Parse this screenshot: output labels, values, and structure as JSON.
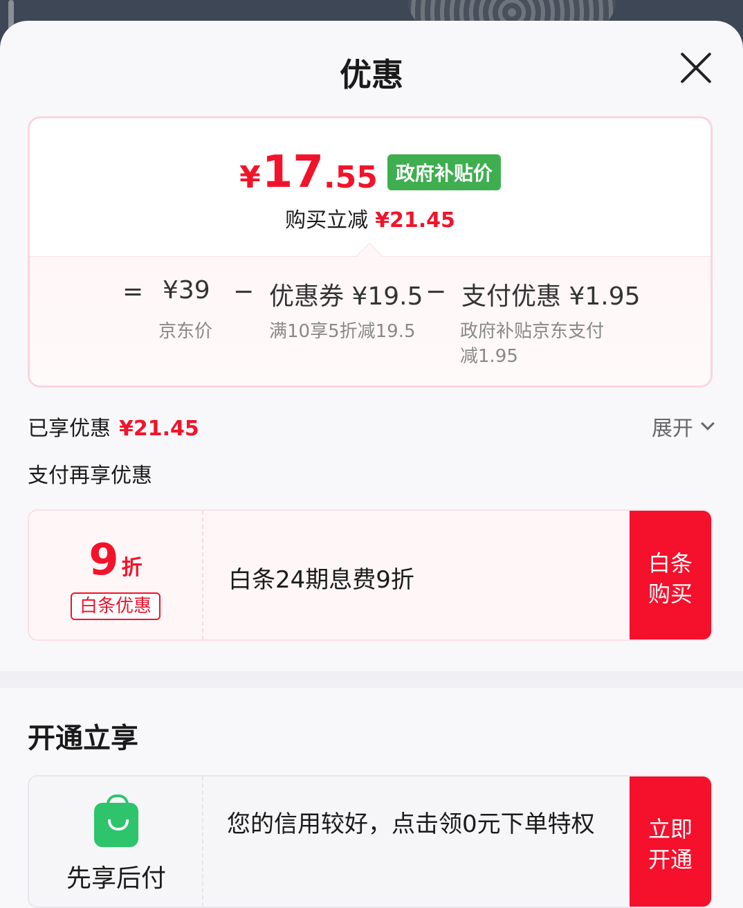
{
  "header": {
    "title": "优惠"
  },
  "price": {
    "yen": "¥",
    "integer": "17",
    "decimal": ".55",
    "tag": "政府补贴价",
    "save_label": "购买立减",
    "save_amount": "¥21.45"
  },
  "formula": {
    "eq": "=",
    "minus": "−",
    "jd_price": "¥39",
    "jd_price_label": "京东价",
    "coupon": "优惠券 ¥19.5",
    "coupon_desc": "满10享5折减19.5",
    "payment": "支付优惠 ¥1.95",
    "payment_desc_1": "政府补贴京东支付",
    "payment_desc_2": "减1.95"
  },
  "enjoyed": {
    "label": "已享优惠",
    "amount": "¥21.45",
    "expand": "展开"
  },
  "pay_again": {
    "label": "支付再享优惠"
  },
  "baitiao_offer": {
    "discount_num": "9",
    "discount_unit": "折",
    "tag": "白条优惠",
    "text": "白条24期息费9折",
    "button_line1": "白条",
    "button_line2": "购买"
  },
  "open_section": {
    "title": "开通立享",
    "product": "先享后付",
    "text": "您的信用较好，点击领0元下单特权",
    "button_line1": "立即",
    "button_line2": "开通"
  },
  "colors": {
    "accent_red": "#f2132b",
    "gov_green": "#3eae4f",
    "bag_green": "#2dc46c"
  },
  "icons": [
    "close-icon",
    "chevron-down-icon",
    "shopping-bag-icon"
  ]
}
